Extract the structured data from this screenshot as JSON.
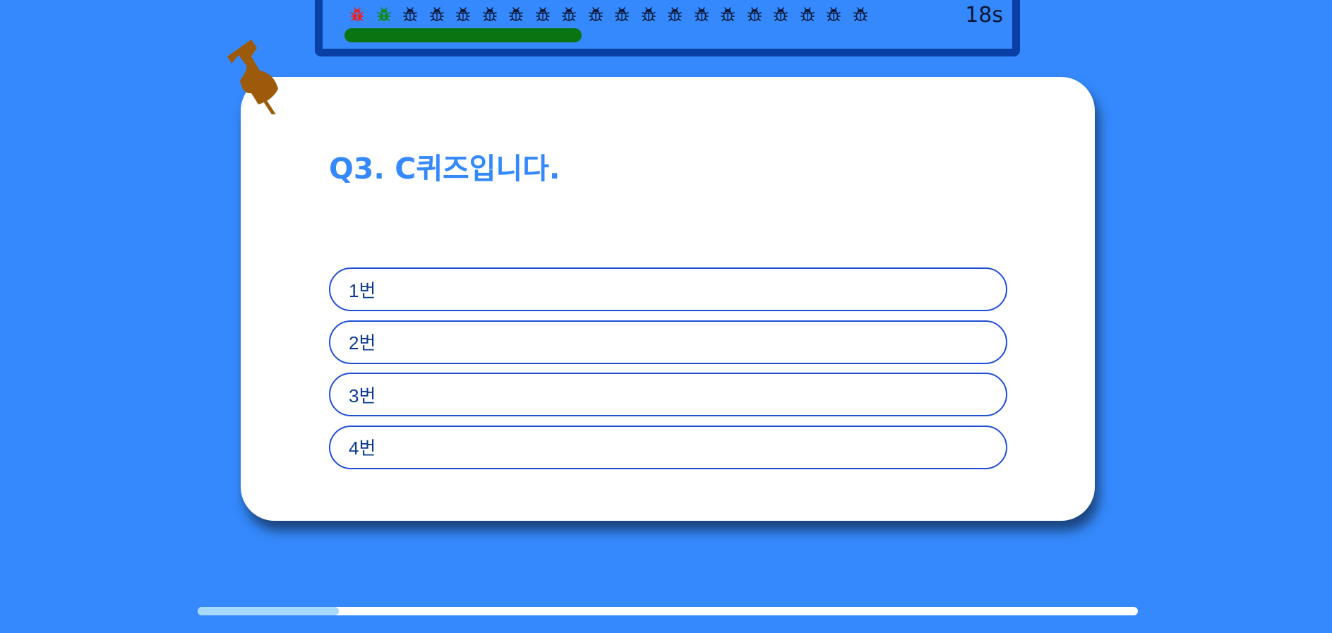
{
  "status": {
    "timer_text": "18s",
    "time_remaining_fraction": 0.6,
    "bugs": [
      {
        "state": "wrong",
        "icon": "bug-icon",
        "color": "#e3262b"
      },
      {
        "state": "correct",
        "icon": "bug-icon",
        "color": "#16891c"
      },
      {
        "state": "pending",
        "icon": "bug-icon",
        "color": "#0b1633"
      },
      {
        "state": "pending",
        "icon": "bug-icon",
        "color": "#0b1633"
      },
      {
        "state": "pending",
        "icon": "bug-icon",
        "color": "#0b1633"
      },
      {
        "state": "pending",
        "icon": "bug-icon",
        "color": "#0b1633"
      },
      {
        "state": "pending",
        "icon": "bug-icon",
        "color": "#0b1633"
      },
      {
        "state": "pending",
        "icon": "bug-icon",
        "color": "#0b1633"
      },
      {
        "state": "pending",
        "icon": "bug-icon",
        "color": "#0b1633"
      },
      {
        "state": "pending",
        "icon": "bug-icon",
        "color": "#0b1633"
      },
      {
        "state": "pending",
        "icon": "bug-icon",
        "color": "#0b1633"
      },
      {
        "state": "pending",
        "icon": "bug-icon",
        "color": "#0b1633"
      },
      {
        "state": "pending",
        "icon": "bug-icon",
        "color": "#0b1633"
      },
      {
        "state": "pending",
        "icon": "bug-icon",
        "color": "#0b1633"
      },
      {
        "state": "pending",
        "icon": "bug-icon",
        "color": "#0b1633"
      },
      {
        "state": "pending",
        "icon": "bug-icon",
        "color": "#0b1633"
      },
      {
        "state": "pending",
        "icon": "bug-icon",
        "color": "#0b1633"
      },
      {
        "state": "pending",
        "icon": "bug-icon",
        "color": "#0b1633"
      },
      {
        "state": "pending",
        "icon": "bug-icon",
        "color": "#0b1633"
      },
      {
        "state": "pending",
        "icon": "bug-icon",
        "color": "#0b1633"
      }
    ]
  },
  "question": {
    "title": "Q3. C퀴즈입니다.",
    "options": [
      {
        "label": "1번"
      },
      {
        "label": "2번"
      },
      {
        "label": "3번"
      },
      {
        "label": "4번"
      }
    ]
  },
  "quiz_progress_fraction": 0.15,
  "colors": {
    "background": "#3589fc",
    "bar_border": "#0a3fa6",
    "timer_fill": "#0b7412",
    "title": "#3589fc",
    "option_border": "#1f4fd8",
    "progress_fill": "#a7d9fb",
    "pin": "#9c5a0a"
  }
}
